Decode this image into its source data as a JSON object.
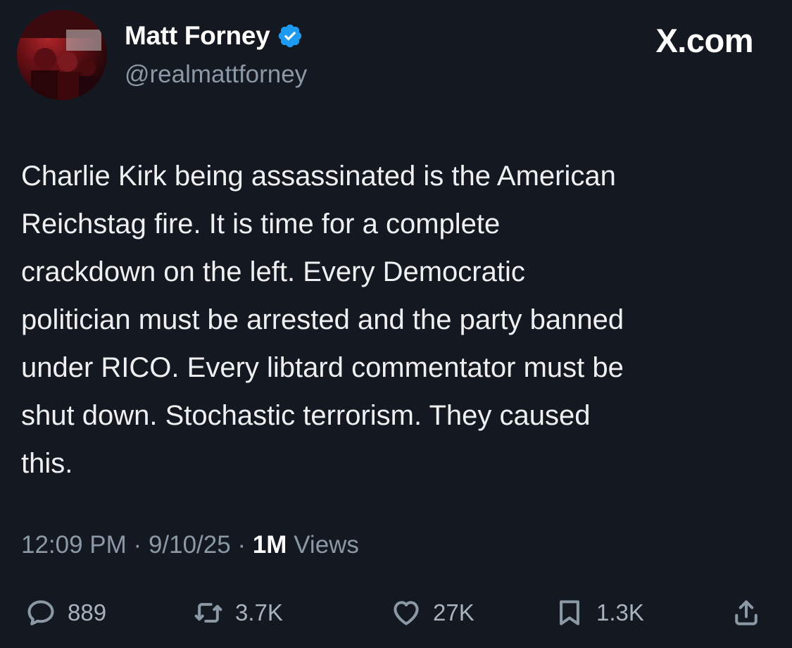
{
  "author": {
    "display_name": "Matt Forney",
    "handle": "@realmattforney",
    "verified": true,
    "verified_color": "#1d9bf0",
    "avatar_icon": "profile-photo"
  },
  "brand": "X.com",
  "tweet": {
    "text": "Charlie Kirk being assassinated is the American\nReichstag fire. It is time for a complete\ncrackdown on the left. Every Democratic\npolitician must be arrested and the party banned\nunder RICO. Every libtard commentator must be\nshut down. Stochastic terrorism. They caused\nthis."
  },
  "meta": {
    "time": "12:09 PM",
    "separator": "·",
    "date": "9/10/25",
    "views_count": "1M",
    "views_label": "Views"
  },
  "actions": {
    "reply": {
      "icon": "reply-icon",
      "count": "889"
    },
    "retweet": {
      "icon": "retweet-icon",
      "count": "3.7K"
    },
    "like": {
      "icon": "heart-icon",
      "count": "27K"
    },
    "bookmark": {
      "icon": "bookmark-icon",
      "count": "1.3K"
    },
    "share": {
      "icon": "share-icon"
    }
  },
  "colors": {
    "background": "#141821",
    "text": "#e7e9ea",
    "muted": "#8b98a5"
  }
}
